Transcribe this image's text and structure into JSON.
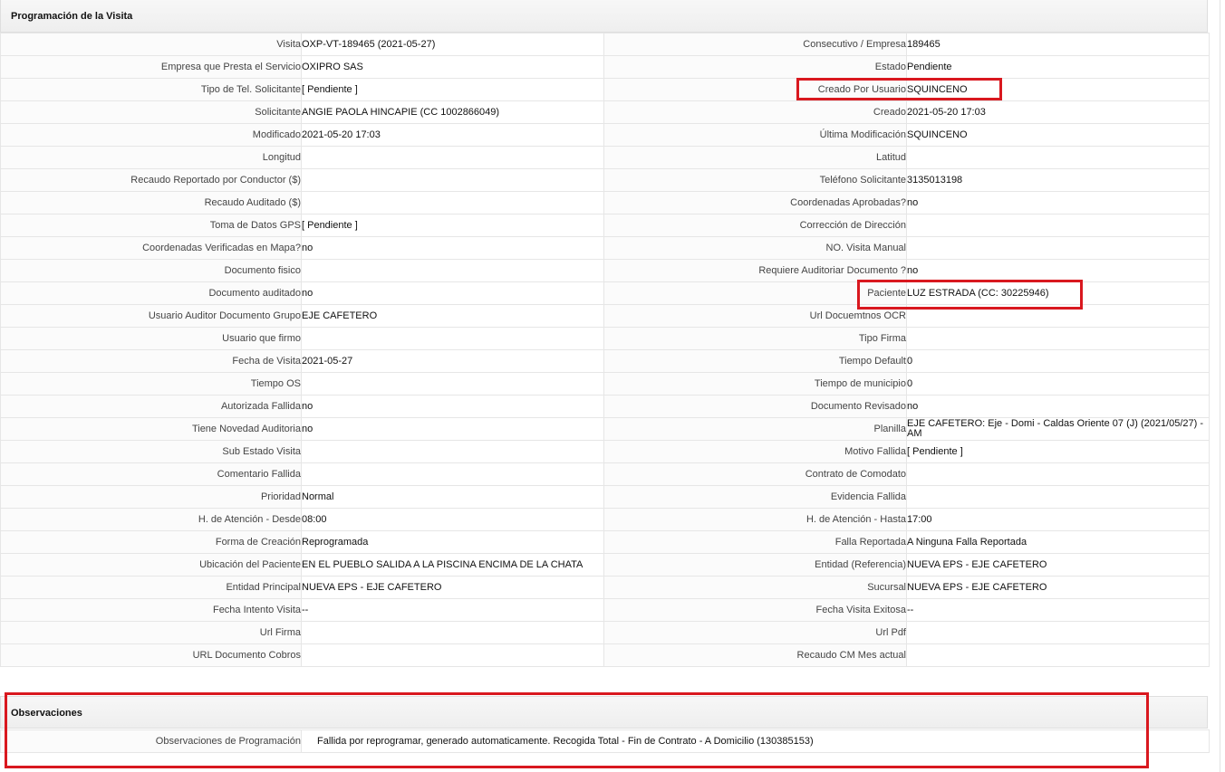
{
  "section_programacion": {
    "title": "Programación de la Visita"
  },
  "rows": [
    {
      "l1": "Visita",
      "v1": "OXP-VT-189465 (2021-05-27)",
      "l2": "Consecutivo / Empresa",
      "v2": "189465"
    },
    {
      "l1": "Empresa que Presta el Servicio",
      "v1": "OXIPRO SAS",
      "l2": "Estado",
      "v2": "Pendiente"
    },
    {
      "l1": "Tipo de Tel. Solicitante",
      "v1": "[ Pendiente ]",
      "l2": "Creado Por Usuario",
      "v2": "SQUINCENO"
    },
    {
      "l1": "Solicitante",
      "v1": "ANGIE PAOLA HINCAPIE (CC 1002866049)",
      "l2": "Creado",
      "v2": "2021-05-20 17:03"
    },
    {
      "l1": "Modificado",
      "v1": "2021-05-20 17:03",
      "l2": "Última Modificación",
      "v2": " SQUINCENO"
    },
    {
      "l1": "Longitud",
      "v1": "",
      "l2": "Latitud",
      "v2": ""
    },
    {
      "l1": "Recaudo Reportado por Conductor ($)",
      "v1": "",
      "l2": "Teléfono Solicitante",
      "v2": "3135013198"
    },
    {
      "l1": "Recaudo Auditado ($)",
      "v1": "",
      "l2": "Coordenadas Aprobadas?",
      "v2": " no"
    },
    {
      "l1": "Toma de Datos GPS",
      "v1": "[ Pendiente ]",
      "l2": "Corrección de Dirección",
      "v2": ""
    },
    {
      "l1": "Coordenadas Verificadas en Mapa?",
      "v1": " no",
      "l2": "NO. Visita Manual",
      "v2": ""
    },
    {
      "l1": "Documento fisico",
      "v1": "",
      "l2": "Requiere Auditoriar Documento ?",
      "v2": " no"
    },
    {
      "l1": "Documento auditado",
      "v1": " no",
      "l2": "Paciente",
      "v2": "LUZ ESTRADA (CC: 30225946)"
    },
    {
      "l1": "Usuario Auditor Documento Grupo",
      "v1": "EJE CAFETERO",
      "l2": "Url Docuemtnos OCR",
      "v2": ""
    },
    {
      "l1": "Usuario que firmo",
      "v1": "",
      "l2": "Tipo Firma",
      "v2": ""
    },
    {
      "l1": "Fecha de Visita",
      "v1": " 2021-05-27",
      "l2": "Tiempo Default",
      "v2": "0"
    },
    {
      "l1": "Tiempo OS",
      "v1": "",
      "l2": "Tiempo de municipio",
      "v2": "0"
    },
    {
      "l1": "Autorizada Fallida",
      "v1": " no",
      "l2": "Documento Revisado",
      "v2": " no"
    },
    {
      "l1": "Tiene Novedad Auditoria",
      "v1": " no",
      "l2": "Planilla",
      "v2": "EJE CAFETERO: Eje - Domi - Caldas Oriente 07 (J) (2021/05/27) - AM"
    },
    {
      "l1": "Sub Estado Visita",
      "v1": "",
      "l2": "Motivo Fallida",
      "v2": "[ Pendiente ]"
    },
    {
      "l1": "Comentario Fallida",
      "v1": "",
      "l2": "Contrato de Comodato",
      "v2": ""
    },
    {
      "l1": "Prioridad",
      "v1": "Normal",
      "l2": "Evidencia Fallida",
      "v2": ""
    },
    {
      "l1": "H. de Atención - Desde",
      "v1": "08:00",
      "l2": "H. de Atención - Hasta",
      "v2": "17:00"
    },
    {
      "l1": "Forma de Creación",
      "v1": "Reprogramada",
      "l2": "Falla Reportada",
      "v2": "A Ninguna Falla Reportada"
    },
    {
      "l1": "Ubicación del Paciente",
      "v1": "EN EL PUEBLO SALIDA A LA PISCINA ENCIMA DE LA CHATA",
      "l2": "Entidad (Referencia)",
      "v2": "NUEVA EPS - EJE CAFETERO"
    },
    {
      "l1": "Entidad Principal",
      "v1": "NUEVA EPS - EJE CAFETERO",
      "l2": "Sucursal",
      "v2": "NUEVA EPS - EJE CAFETERO"
    },
    {
      "l1": "Fecha Intento Visita",
      "v1": " --",
      "l2": "Fecha Visita Exitosa",
      "v2": " --"
    },
    {
      "l1": "Url Firma",
      "v1": "",
      "l2": "Url Pdf",
      "v2": ""
    },
    {
      "l1": "URL Documento Cobros",
      "v1": "",
      "l2": "Recaudo CM Mes actual",
      "v2": ""
    }
  ],
  "section_observaciones": {
    "title": "Observaciones",
    "label": "Observaciones de Programación",
    "value": "Fallida por reprogramar, generado automaticamente. Recogida Total - Fin de Contrato - A Domicilio (130385153)"
  },
  "colors": {
    "highlight": "#d9181f"
  }
}
